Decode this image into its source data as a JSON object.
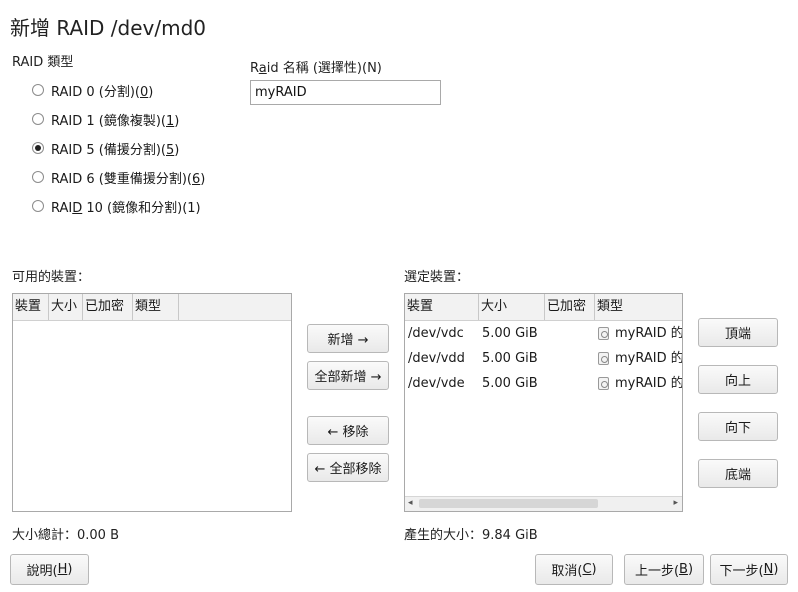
{
  "dialog": {
    "title": "新增 RAID /dev/md0"
  },
  "raid_type": {
    "label": "RAID 類型",
    "options": [
      {
        "label": "RAID 0 (分割)(",
        "key": "0",
        "suffix": ")",
        "selected": false
      },
      {
        "label": "RAID 1 (鏡像複製)(",
        "key": "1",
        "suffix": ")",
        "selected": false
      },
      {
        "label": "RAID 5 (備援分割)(",
        "key": "5",
        "suffix": ")",
        "selected": true
      },
      {
        "label": "RAID 6 (雙重備援分割)(",
        "key": "6",
        "suffix": ")",
        "selected": false
      },
      {
        "label": "RAI",
        "key": "D",
        "suffix": " 10 (鏡像和分割)(1)",
        "selected": false
      }
    ]
  },
  "raid_name": {
    "label_pre": "R",
    "label_key": "a",
    "label_post": "id 名稱 (選擇性)(N)",
    "value": "myRAID"
  },
  "available": {
    "label": "可用的裝置：",
    "columns": [
      "裝置",
      "大小",
      "已加密",
      "類型"
    ],
    "total": "大小總計：0.00 B"
  },
  "selected": {
    "label": "選定裝置：",
    "columns": [
      "裝置",
      "大小",
      "已加密",
      "類型"
    ],
    "rows": [
      {
        "device": "/dev/vdc",
        "size": "5.00 GiB",
        "encrypted": "",
        "type": "myRAID 的"
      },
      {
        "device": "/dev/vdd",
        "size": "5.00 GiB",
        "encrypted": "",
        "type": "myRAID 的"
      },
      {
        "device": "/dev/vde",
        "size": "5.00 GiB",
        "encrypted": "",
        "type": "myRAID 的"
      }
    ],
    "result_size": "產生的大小：9.84 GiB"
  },
  "transfer": {
    "add": "新增 →",
    "add_all": "全部新增 →",
    "remove": "← 移除",
    "remove_all": "← 全部移除"
  },
  "order": {
    "top": "頂端",
    "up": "向上",
    "down": "向下",
    "bottom": "底端"
  },
  "footer": {
    "help_pre": "說明(",
    "help_key": "H",
    "help_post": ")",
    "cancel_pre": "取消(",
    "cancel_key": "C",
    "cancel_post": ")",
    "back_pre": "上一步(",
    "back_key": "B",
    "back_post": ")",
    "next_pre": "下一步(",
    "next_key": "N",
    "next_post": ")"
  }
}
